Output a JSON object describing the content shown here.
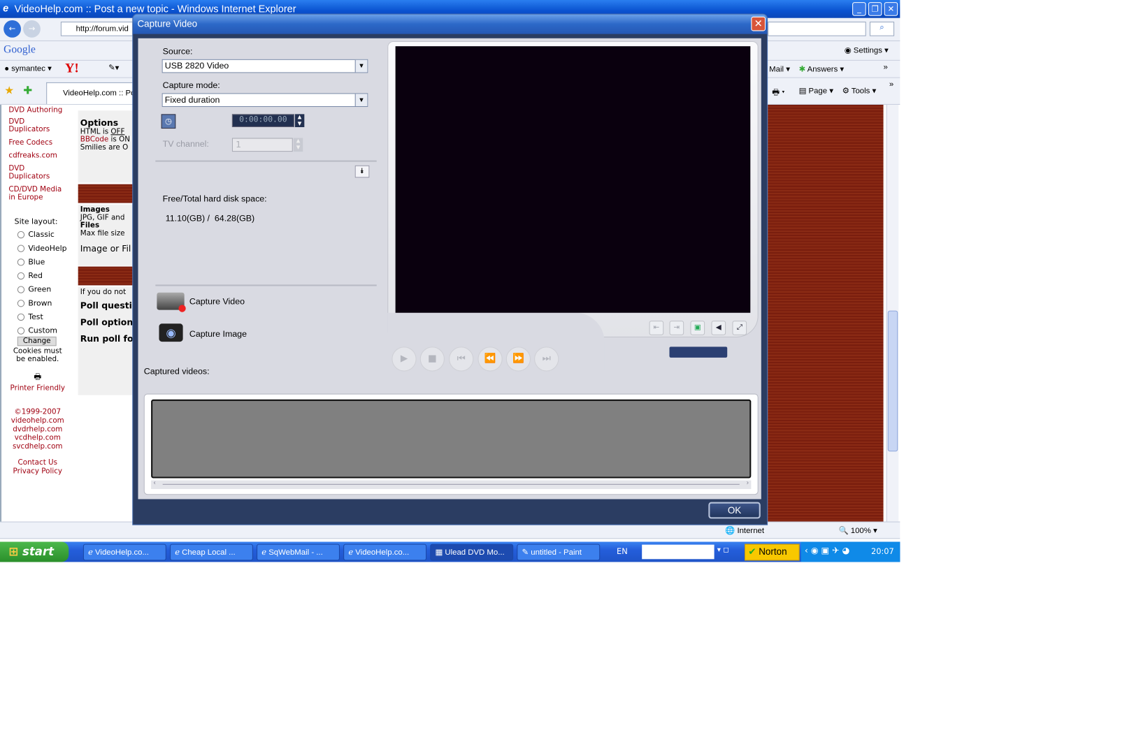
{
  "browser": {
    "title": "VideoHelp.com :: Post a new topic - Windows Internet Explorer",
    "address": "http://forum.vid",
    "tab": "VideoHelp.com :: Pos",
    "toolbar": {
      "google": "Google",
      "symantec": "symantec",
      "yahoo": "Y!",
      "settings": "Settings",
      "mail": "Mail",
      "answers": "Answers",
      "page": "Page",
      "tools": "Tools",
      "more": "»"
    },
    "sidebar": {
      "links": [
        "DVD Authoring",
        "DVD Duplicators",
        "Free Codecs",
        "cdfreaks.com",
        "DVD Duplicators",
        "CD/DVD Media in Europe"
      ],
      "site_layout": "Site layout:",
      "layouts": [
        "Classic",
        "VideoHelp",
        "Blue",
        "Red",
        "Green",
        "Brown",
        "Test",
        "Custom"
      ],
      "change": "Change",
      "cookies": "Cookies must be enabled.",
      "printer": "Printer Friendly",
      "copyright": [
        "©1999-2007",
        "videohelp.com",
        "dvdrhelp.com",
        "vcdhelp.com",
        "svcdhelp.com"
      ],
      "contact": "Contact Us",
      "privacy": "Privacy Policy"
    },
    "content": {
      "options": "Options",
      "html": "HTML is ",
      "html_val": "OFF",
      "bbcode": "BBCode",
      "bbcode_rest": " is ON",
      "smilies": "Smilies are O",
      "images": "Images",
      "images_text": "JPG, GIF and",
      "files": "Files",
      "files_text": "Max file size",
      "image_or_file": "Image or Fil",
      "if_not": "If you do not",
      "poll_q": "Poll questio",
      "poll_opt": "Poll option",
      "run_poll": "Run poll for"
    },
    "status": {
      "zone": "Internet",
      "zoom": "100%"
    }
  },
  "dialog": {
    "title": "Capture Video",
    "source_label": "Source:",
    "source_value": "USB 2820 Video",
    "mode_label": "Capture mode:",
    "mode_value": "Fixed duration",
    "duration": "0:00:00.00",
    "tv_label": "TV channel:",
    "tv_value": "1",
    "disk_label": "Free/Total hard disk space:",
    "disk_value": "11.10(GB) /  64.28(GB)",
    "capture_video": "Capture Video",
    "capture_image": "Capture Image",
    "captured_label": "Captured videos:",
    "ok": "OK"
  },
  "taskbar": {
    "start": "start",
    "items": [
      "VideoHelp.co...",
      "Cheap Local ...",
      "SqWebMail - ...",
      "VideoHelp.co...",
      "Ulead DVD Mo...",
      "untitled - Paint"
    ],
    "active_index": 4,
    "lang": "EN",
    "norton": "Norton",
    "clock": "20:07"
  }
}
